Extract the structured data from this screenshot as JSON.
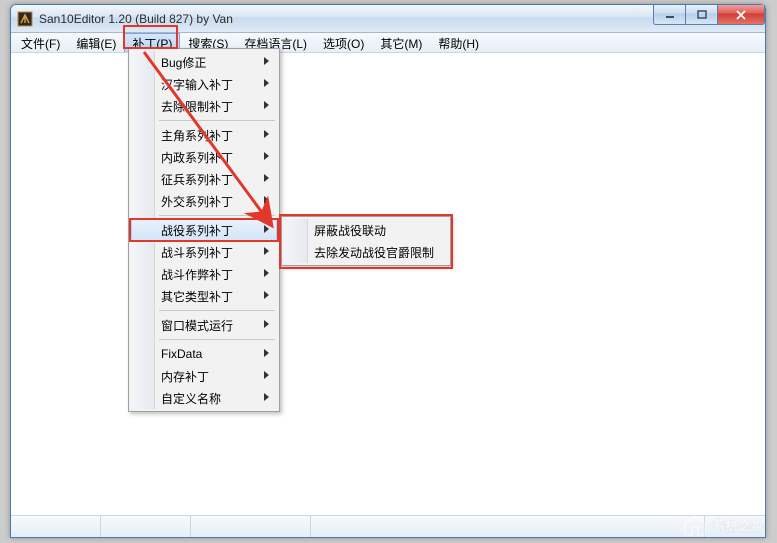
{
  "window": {
    "title": "San10Editor 1.20 (Build 827) by Van"
  },
  "menubar": [
    {
      "label": "文件(F)"
    },
    {
      "label": "编辑(E)"
    },
    {
      "label": "补丁(P)",
      "open": true
    },
    {
      "label": "搜索(S)"
    },
    {
      "label": "存档语言(L)"
    },
    {
      "label": "选项(O)"
    },
    {
      "label": "其它(M)"
    },
    {
      "label": "帮助(H)"
    }
  ],
  "dropdown": {
    "groups": [
      [
        "Bug修正",
        "汉字输入补丁",
        "去除限制补丁"
      ],
      [
        "主角系列补丁",
        "内政系列补丁",
        "征兵系列补丁",
        "外交系列补丁"
      ],
      [
        "战役系列补丁",
        "战斗系列补丁",
        "战斗作弊补丁",
        "其它类型补丁"
      ],
      [
        "窗口模式运行"
      ],
      [
        "FixData",
        "内存补丁",
        "自定义名称"
      ]
    ],
    "selected": "战役系列补丁"
  },
  "submenu": [
    "屏蔽战役联动",
    "去除发动战役官爵限制"
  ],
  "watermark": "系统之家"
}
